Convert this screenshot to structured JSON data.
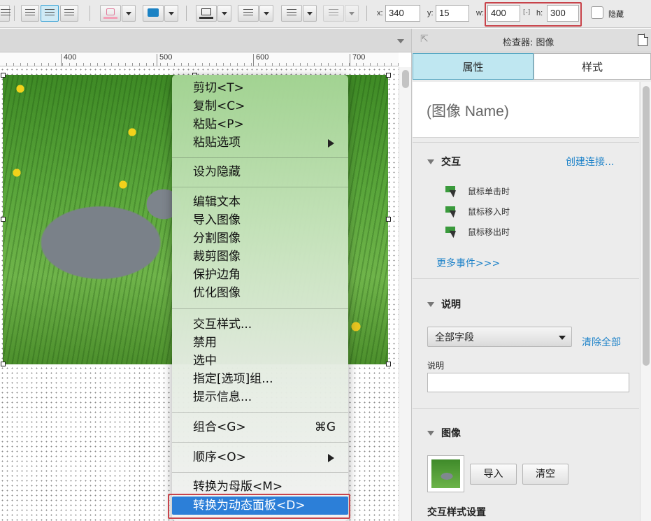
{
  "toolbar": {
    "x_label": "x:",
    "x_value": "340",
    "y_label": "y:",
    "y_value": "15",
    "w_label": "w:",
    "w_value": "400",
    "lock_label": "[-]",
    "h_label": "h:",
    "h_value": "300",
    "hidden_label": "隐藏"
  },
  "ruler": {
    "labels": [
      "400",
      "500",
      "600",
      "700"
    ]
  },
  "context_menu": {
    "items": [
      {
        "label": "剪切<T>"
      },
      {
        "label": "复制<C>"
      },
      {
        "label": "粘贴<P>"
      },
      {
        "label": "粘贴选项"
      },
      {
        "label": "设为隐藏"
      },
      {
        "label": "编辑文本"
      },
      {
        "label": "导入图像"
      },
      {
        "label": "分割图像"
      },
      {
        "label": "裁剪图像"
      },
      {
        "label": "保护边角"
      },
      {
        "label": "优化图像"
      },
      {
        "label": "交互样式..."
      },
      {
        "label": "禁用"
      },
      {
        "label": "选中"
      },
      {
        "label": "指定[选项]组..."
      },
      {
        "label": "提示信息..."
      },
      {
        "label": "组合<G>",
        "shortcut": "⌘G"
      },
      {
        "label": "顺序<O>"
      },
      {
        "label": "转换为母版<M>"
      },
      {
        "label": "转换为动态面板<D>"
      }
    ]
  },
  "inspector": {
    "title": "检查器: 图像",
    "tabs": [
      "属性",
      "样式"
    ],
    "name_placeholder": "(图像 Name)",
    "interaction": {
      "header": "交互",
      "create_link": "创建连接...",
      "events": [
        "鼠标单击时",
        "鼠标移入时",
        "鼠标移出时"
      ],
      "more_events": "更多事件>>>"
    },
    "notes": {
      "header": "说明",
      "field_select": "全部字段",
      "clear_all": "清除全部",
      "field_label": "说明",
      "field_value": ""
    },
    "image": {
      "header": "图像",
      "import_button": "导入",
      "clear_button": "清空",
      "interaction_style_label": "交互样式设置"
    }
  },
  "colors": {
    "highlight_border": "#c8434a",
    "selected_menu_item": "#2c7fd8",
    "active_tab": "#bfe7f1",
    "link": "#1f83c9"
  }
}
